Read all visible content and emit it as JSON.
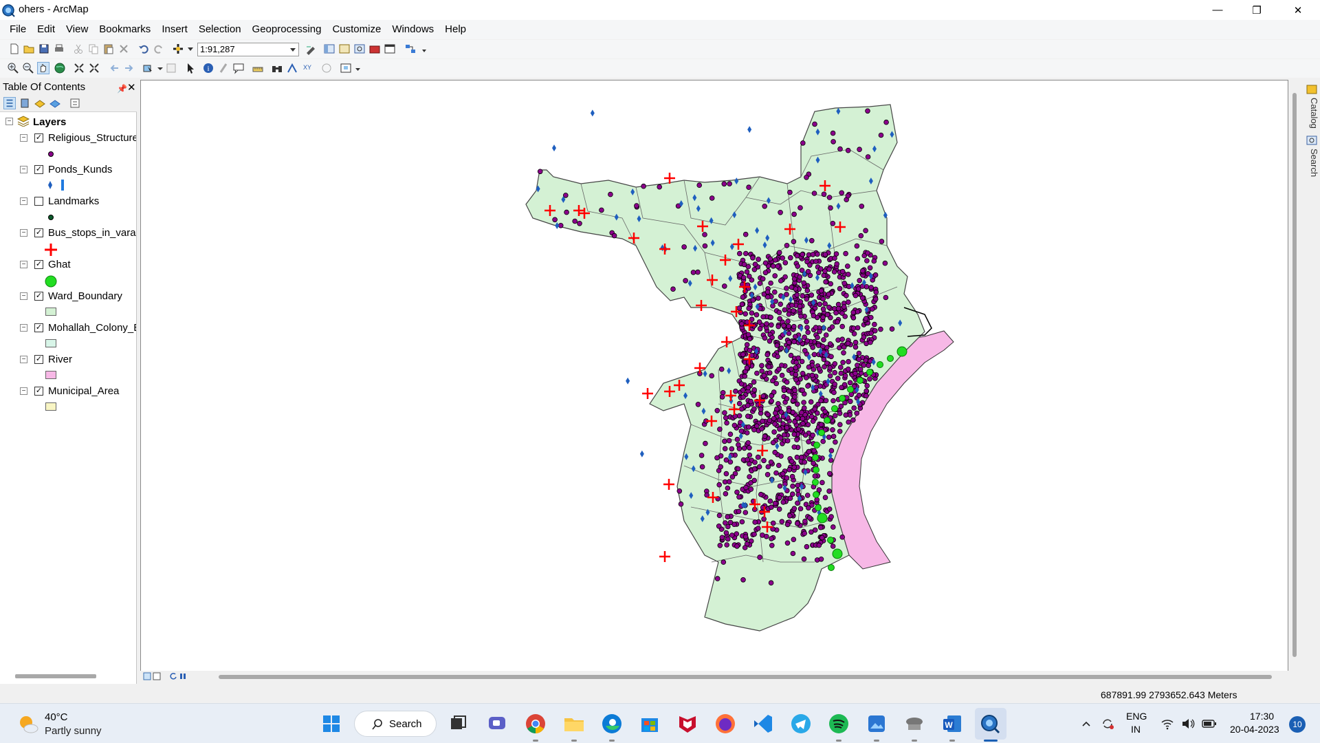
{
  "window": {
    "title": "ohers - ArcMap",
    "minimize_glyph": "—",
    "maximize_glyph": "❐",
    "close_glyph": "✕"
  },
  "menu": [
    "File",
    "Edit",
    "View",
    "Bookmarks",
    "Insert",
    "Selection",
    "Geoprocessing",
    "Customize",
    "Windows",
    "Help"
  ],
  "toolbar": {
    "scale_value": "1:91,287"
  },
  "toc": {
    "title": "Table Of Contents",
    "pin_glyph": "📌",
    "close_glyph": "✕",
    "root_label": "Layers",
    "layers": [
      {
        "name": "Religious_Structure",
        "checked": true,
        "symbol": "purple-dot"
      },
      {
        "name": "Ponds_Kunds",
        "checked": true,
        "symbol": "blue-diamond"
      },
      {
        "name": "Landmarks",
        "checked": false,
        "symbol": "dark-green-dot"
      },
      {
        "name": "Bus_stops_in_varana",
        "checked": true,
        "symbol": "red-cross"
      },
      {
        "name": "Ghat",
        "checked": true,
        "symbol": "green-circle"
      },
      {
        "name": "Ward_Boundary",
        "checked": true,
        "symbol": "light-green-fill"
      },
      {
        "name": "Mohallah_Colony_E",
        "checked": true,
        "symbol": "pale-green-fill"
      },
      {
        "name": "River",
        "checked": true,
        "symbol": "pink-fill"
      },
      {
        "name": "Municipal_Area",
        "checked": true,
        "symbol": "pale-yellow-fill"
      }
    ]
  },
  "dock": {
    "catalog_label": "Catalog",
    "search_label": "Search"
  },
  "status": {
    "coordinates": "687891.99  2793652.643 Meters"
  },
  "taskbar": {
    "weather_temp": "40°C",
    "weather_desc": "Partly sunny",
    "search_label": "Search",
    "lang_line1": "ENG",
    "lang_line2": "IN",
    "time": "17:30",
    "date": "20-04-2023",
    "notification_count": "10"
  },
  "colors": {
    "ward_fill": "#d4f1d4",
    "river_fill": "#f7b8e6",
    "religious": "#8b008b",
    "ponds": "#1f5fbf",
    "bus_stop": "#ff0000",
    "ghat": "#22dd22",
    "accent": "#1a5fb4"
  }
}
